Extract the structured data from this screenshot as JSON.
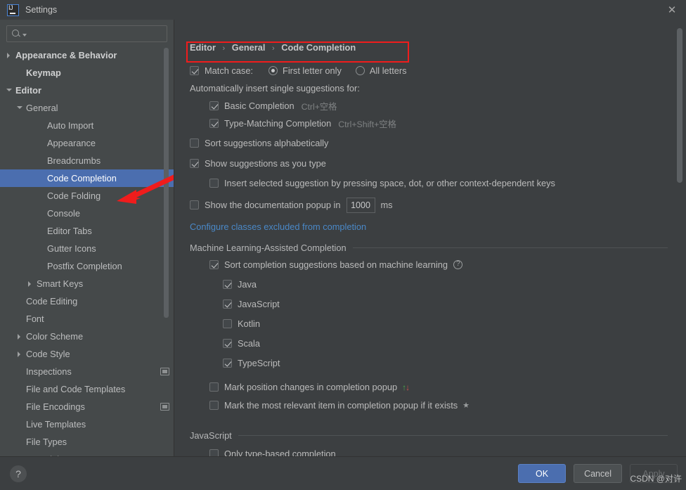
{
  "window": {
    "title": "Settings",
    "logo_icon": "intellij-idea-logo",
    "close_icon": "close-icon"
  },
  "sidebar": {
    "search": {
      "placeholder": "",
      "value": "",
      "icon": "search-icon"
    },
    "items": [
      {
        "label": "Appearance & Behavior",
        "indent": 0,
        "arrow": "right",
        "bold": true,
        "selected": false,
        "badge": false
      },
      {
        "label": "Keymap",
        "indent": 1,
        "arrow": "none",
        "bold": true,
        "selected": false,
        "badge": false
      },
      {
        "label": "Editor",
        "indent": 0,
        "arrow": "down",
        "bold": true,
        "selected": false,
        "badge": false
      },
      {
        "label": "General",
        "indent": 1,
        "arrow": "down",
        "bold": false,
        "selected": false,
        "badge": false
      },
      {
        "label": "Auto Import",
        "indent": 3,
        "arrow": "none",
        "bold": false,
        "selected": false,
        "badge": false
      },
      {
        "label": "Appearance",
        "indent": 3,
        "arrow": "none",
        "bold": false,
        "selected": false,
        "badge": false
      },
      {
        "label": "Breadcrumbs",
        "indent": 3,
        "arrow": "none",
        "bold": false,
        "selected": false,
        "badge": false
      },
      {
        "label": "Code Completion",
        "indent": 3,
        "arrow": "none",
        "bold": false,
        "selected": true,
        "badge": false
      },
      {
        "label": "Code Folding",
        "indent": 3,
        "arrow": "none",
        "bold": false,
        "selected": false,
        "badge": false
      },
      {
        "label": "Console",
        "indent": 3,
        "arrow": "none",
        "bold": false,
        "selected": false,
        "badge": false
      },
      {
        "label": "Editor Tabs",
        "indent": 3,
        "arrow": "none",
        "bold": false,
        "selected": false,
        "badge": false
      },
      {
        "label": "Gutter Icons",
        "indent": 3,
        "arrow": "none",
        "bold": false,
        "selected": false,
        "badge": false
      },
      {
        "label": "Postfix Completion",
        "indent": 3,
        "arrow": "none",
        "bold": false,
        "selected": false,
        "badge": false
      },
      {
        "label": "Smart Keys",
        "indent": 2,
        "arrow": "right",
        "bold": false,
        "selected": false,
        "badge": false
      },
      {
        "label": "Code Editing",
        "indent": 1,
        "arrow": "none",
        "bold": false,
        "selected": false,
        "badge": false
      },
      {
        "label": "Font",
        "indent": 1,
        "arrow": "none",
        "bold": false,
        "selected": false,
        "badge": false
      },
      {
        "label": "Color Scheme",
        "indent": 1,
        "arrow": "right",
        "bold": false,
        "selected": false,
        "badge": false
      },
      {
        "label": "Code Style",
        "indent": 1,
        "arrow": "right",
        "bold": false,
        "selected": false,
        "badge": false
      },
      {
        "label": "Inspections",
        "indent": 1,
        "arrow": "none",
        "bold": false,
        "selected": false,
        "badge": true
      },
      {
        "label": "File and Code Templates",
        "indent": 1,
        "arrow": "none",
        "bold": false,
        "selected": false,
        "badge": false
      },
      {
        "label": "File Encodings",
        "indent": 1,
        "arrow": "none",
        "bold": false,
        "selected": false,
        "badge": true
      },
      {
        "label": "Live Templates",
        "indent": 1,
        "arrow": "none",
        "bold": false,
        "selected": false,
        "badge": false
      },
      {
        "label": "File Types",
        "indent": 1,
        "arrow": "none",
        "bold": false,
        "selected": false,
        "badge": false
      },
      {
        "label": "Copyright",
        "indent": 1,
        "arrow": "right",
        "bold": false,
        "selected": false,
        "badge": false
      }
    ],
    "scrollbar": "sidebar-scrollbar"
  },
  "main": {
    "breadcrumb": {
      "part1": "Editor",
      "part2": "General",
      "part3": "Code Completion",
      "separator": "›"
    },
    "match_case": {
      "label": "Match case:",
      "checked": true,
      "options": [
        {
          "label": "First letter only",
          "selected": true
        },
        {
          "label": "All letters",
          "selected": false
        }
      ]
    },
    "auto_insert_heading": "Automatically insert single suggestions for:",
    "auto_insert_options": [
      {
        "label": "Basic Completion",
        "shortcut": "Ctrl+空格",
        "checked": true
      },
      {
        "label": "Type-Matching Completion",
        "shortcut": "Ctrl+Shift+空格",
        "checked": true
      }
    ],
    "sort_alphabetically": {
      "label": "Sort suggestions alphabetically",
      "checked": false
    },
    "show_as_you_type": {
      "label": "Show suggestions as you type",
      "checked": true
    },
    "insert_on_keys": {
      "label": "Insert selected suggestion by pressing space, dot, or other context-dependent keys",
      "checked": false
    },
    "doc_popup": {
      "label": "Show the documentation popup in",
      "checked": false,
      "value": "1000",
      "unit": "ms"
    },
    "configure_link": "Configure classes excluded from completion",
    "ml_group": {
      "title": "Machine Learning-Assisted Completion",
      "sort_ml": {
        "label": "Sort completion suggestions based on machine learning",
        "checked": true,
        "help_icon": "help-icon"
      },
      "languages": [
        {
          "label": "Java",
          "checked": true
        },
        {
          "label": "JavaScript",
          "checked": true
        },
        {
          "label": "Kotlin",
          "checked": false
        },
        {
          "label": "Scala",
          "checked": true
        },
        {
          "label": "TypeScript",
          "checked": true
        }
      ],
      "mark_position": {
        "label": "Mark position changes in completion popup",
        "checked": false,
        "up_glyph": "↑",
        "down_glyph": "↓"
      },
      "mark_relevant": {
        "label": "Mark the most relevant item in completion popup if it exists",
        "checked": false,
        "star_glyph": "★"
      }
    },
    "js_group": {
      "title": "JavaScript",
      "only_type_based": {
        "label_a": "Only type-based ",
        "label_b": "c",
        "label_c": "ompletion",
        "checked": false
      }
    },
    "scrollbar": "main-scrollbar"
  },
  "footer": {
    "help_label": "?",
    "ok_label": "OK",
    "cancel_label": "Cancel",
    "apply_label": "Apply"
  },
  "annotations": {
    "red_arrow": "red-arrow-pointer",
    "red_box": "red-highlight-box",
    "watermark": "CSDN @对许"
  },
  "colors": {
    "accent": "#4b6eaf",
    "background": "#3c3f41",
    "sidebar_bg": "#45494a",
    "link": "#4a88c7",
    "annotation_red": "#f01c1c"
  }
}
